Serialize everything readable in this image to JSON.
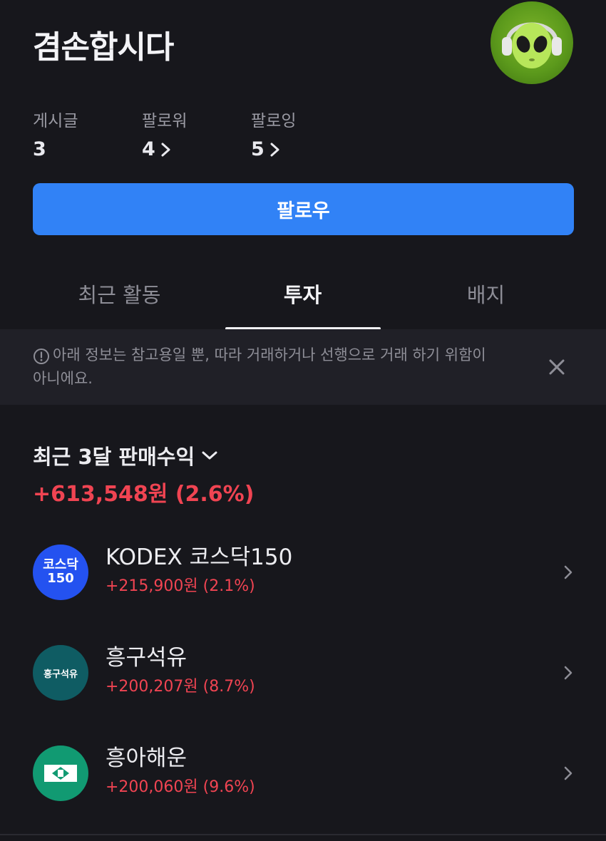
{
  "profile": {
    "username": "겸손합시다",
    "avatar_icon": "alien-headphones-avatar-icon"
  },
  "stats": {
    "posts": {
      "label": "게시글",
      "value": "3"
    },
    "followers": {
      "label": "팔로워",
      "value": "4"
    },
    "following": {
      "label": "팔로잉",
      "value": "5"
    }
  },
  "follow_button": {
    "label": "팔로우"
  },
  "tabs": [
    {
      "label": "최근 활동",
      "active": false
    },
    {
      "label": "투자",
      "active": true
    },
    {
      "label": "배지",
      "active": false
    }
  ],
  "notice": {
    "text": "아래 정보는 참고용일 뿐, 따라 거래하거나 선행으로 거래 하기 위함이 아니에요.",
    "icon": "info-circle-icon",
    "close_icon": "close-icon"
  },
  "summary": {
    "title": "최근 3달 판매수익",
    "value": "+613,548원 (2.6%)"
  },
  "holdings": [
    {
      "name": "KODEX 코스닥150",
      "profit": "+215,900원 (2.1%)",
      "logo_line1": "코스닥",
      "logo_line2": "150"
    },
    {
      "name": "흥구석유",
      "profit": "+200,207원 (8.7%)",
      "logo_text": "흥구석유"
    },
    {
      "name": "흥아해운",
      "profit": "+200,060원 (9.6%)"
    }
  ],
  "colors": {
    "background": "#17171c",
    "accent_blue": "#3182f6",
    "profit_red": "#f04452",
    "notice_bg": "#202027"
  }
}
